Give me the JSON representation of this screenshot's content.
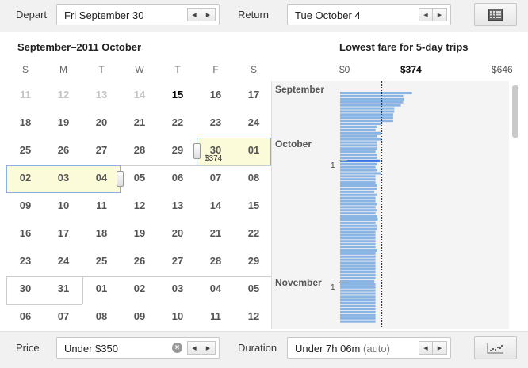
{
  "top": {
    "depart_label": "Depart",
    "depart_value": "Fri September 30",
    "return_label": "Return",
    "return_value": "Tue October 4"
  },
  "calendar": {
    "title": "September–2011 October",
    "weekdays": [
      "S",
      "M",
      "T",
      "W",
      "T",
      "F",
      "S"
    ],
    "weeks": [
      [
        "11",
        "12",
        "13",
        "14",
        "15",
        "16",
        "17"
      ],
      [
        "18",
        "19",
        "20",
        "21",
        "22",
        "23",
        "24"
      ],
      [
        "25",
        "26",
        "27",
        "28",
        "29",
        "30",
        "01"
      ],
      [
        "02",
        "03",
        "04",
        "05",
        "06",
        "07",
        "08"
      ],
      [
        "09",
        "10",
        "11",
        "12",
        "13",
        "14",
        "15"
      ],
      [
        "16",
        "17",
        "18",
        "19",
        "20",
        "21",
        "22"
      ],
      [
        "23",
        "24",
        "25",
        "26",
        "27",
        "28",
        "29"
      ],
      [
        "30",
        "31",
        "01",
        "02",
        "03",
        "04",
        "05"
      ],
      [
        "06",
        "07",
        "08",
        "09",
        "10",
        "11",
        "12"
      ]
    ],
    "selected_price": "$374"
  },
  "fare_chart": {
    "title": "Lowest fare for 5-day trips",
    "axis_min": "$0",
    "axis_marker": "$374",
    "axis_max": "$646",
    "months": [
      "September",
      "October",
      "November"
    ],
    "month_ticks": [
      "1",
      "1"
    ],
    "marker_value": 374,
    "max_value": 646,
    "highlight_index": 22,
    "fares": [
      325,
      285,
      290,
      285,
      275,
      245,
      245,
      240,
      240,
      240,
      185,
      165,
      160,
      185,
      165,
      190,
      165,
      165,
      165,
      160,
      165,
      165,
      180,
      165,
      160,
      165,
      185,
      160,
      160,
      160,
      165,
      165,
      155,
      165,
      160,
      160,
      165,
      160,
      165,
      160,
      165,
      170,
      160,
      165,
      165,
      160,
      160,
      160,
      160,
      160,
      160,
      165,
      160,
      160,
      160,
      160,
      160,
      160,
      160,
      160,
      160,
      155,
      160,
      160,
      160,
      160,
      160,
      160,
      160,
      160,
      160,
      160,
      160,
      160,
      160
    ]
  },
  "bottom": {
    "price_label": "Price",
    "price_value": "Under $350",
    "duration_label": "Duration",
    "duration_value": "Under 7h 06m",
    "duration_note": "(auto)"
  },
  "colors": {
    "bar": "#8ab4e4",
    "bar_highlight": "#3b78e7",
    "selection": "#fcfbd9"
  },
  "icons": [
    "calendar-icon",
    "scatter-chart-icon",
    "clear-icon"
  ]
}
